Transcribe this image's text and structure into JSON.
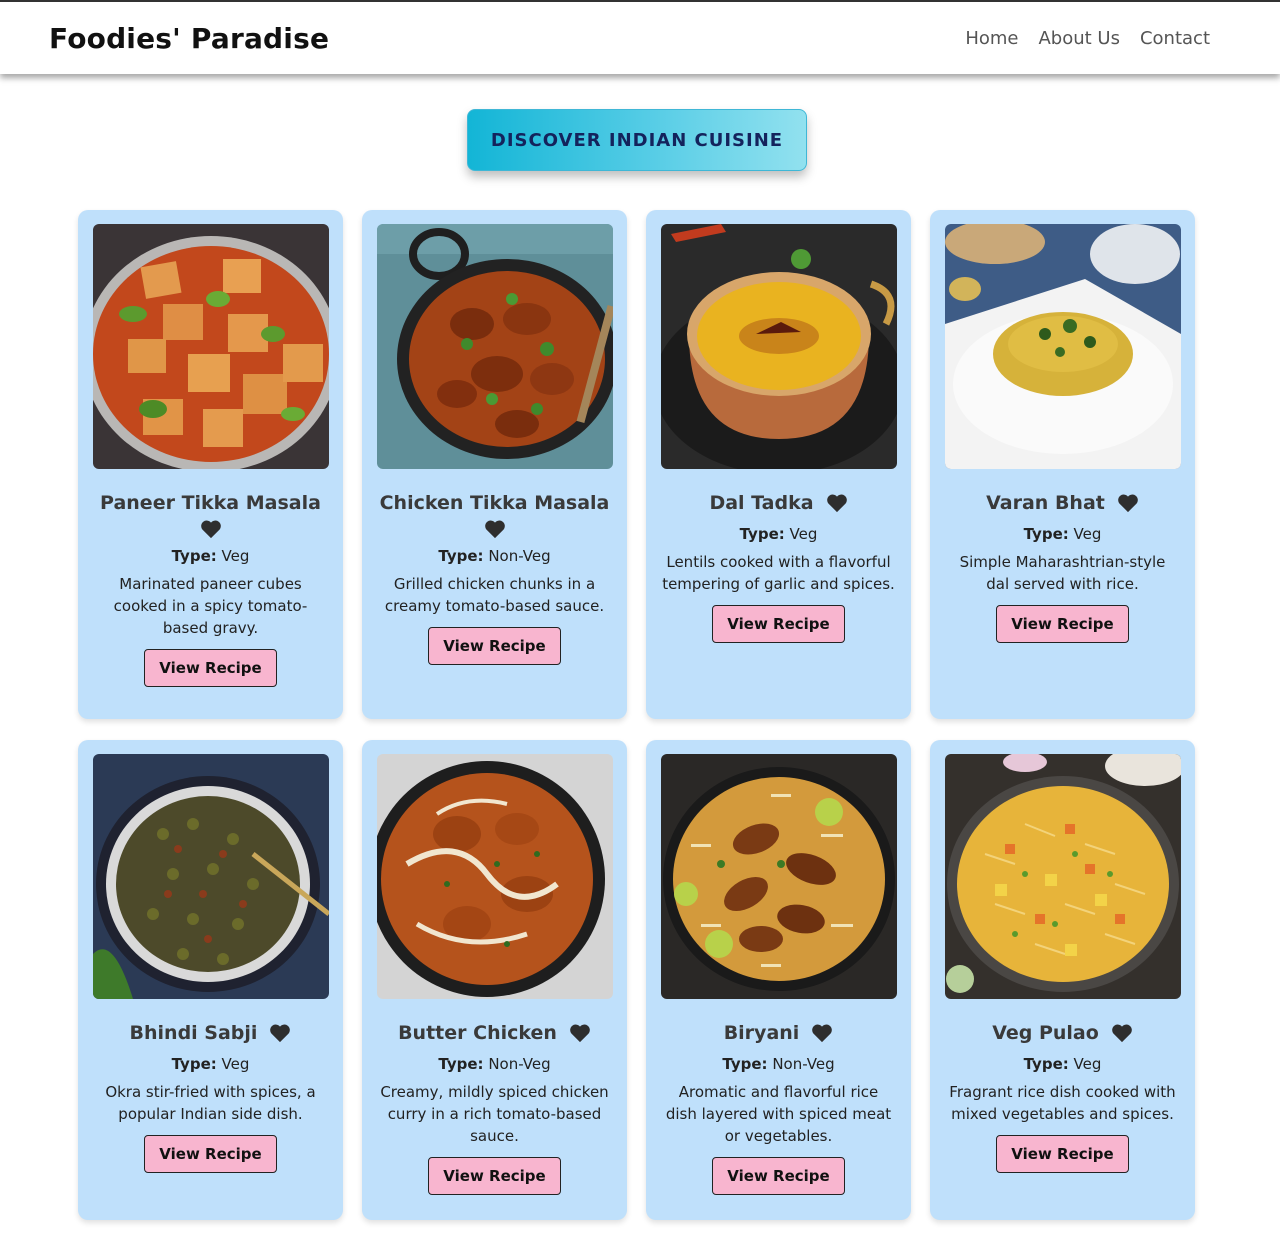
{
  "header": {
    "brand": "Foodies' Paradise",
    "nav": [
      "Home",
      "About Us",
      "Contact"
    ]
  },
  "hero": {
    "button_label": "DISCOVER INDIAN CUISINE"
  },
  "cards": [
    {
      "title": "Paneer Tikka Masala",
      "type_label": "Type:",
      "type": "Veg",
      "description": "Marinated paneer cubes cooked in a spicy tomato-based gravy.",
      "button": "View Recipe"
    },
    {
      "title": "Chicken Tikka Masala",
      "type_label": "Type:",
      "type": "Non-Veg",
      "description": "Grilled chicken chunks in a creamy tomato-based sauce.",
      "button": "View Recipe"
    },
    {
      "title": "Dal Tadka",
      "type_label": "Type:",
      "type": "Veg",
      "description": "Lentils cooked with a flavorful tempering of garlic and spices.",
      "button": "View Recipe"
    },
    {
      "title": "Varan Bhat",
      "type_label": "Type:",
      "type": "Veg",
      "description": "Simple Maharashtrian-style dal served with rice.",
      "button": "View Recipe"
    },
    {
      "title": "Bhindi Sabji",
      "type_label": "Type:",
      "type": "Veg",
      "description": "Okra stir-fried with spices, a popular Indian side dish.",
      "button": "View Recipe"
    },
    {
      "title": "Butter Chicken",
      "type_label": "Type:",
      "type": "Non-Veg",
      "description": "Creamy, mildly spiced chicken curry in a rich tomato-based sauce.",
      "button": "View Recipe"
    },
    {
      "title": "Biryani",
      "type_label": "Type:",
      "type": "Non-Veg",
      "description": "Aromatic and flavorful rice dish layered with spiced meat or vegetables.",
      "button": "View Recipe"
    },
    {
      "title": "Veg Pulao",
      "type_label": "Type:",
      "type": "Veg",
      "description": "Fragrant rice dish cooked with mixed vegetables and spices.",
      "button": "View Recipe"
    }
  ],
  "colors": {
    "card_bg": "#bfe0fb",
    "button_bg": "#f8b5cf",
    "hero_start": "#13b5d6",
    "hero_end": "#92e1ef"
  }
}
